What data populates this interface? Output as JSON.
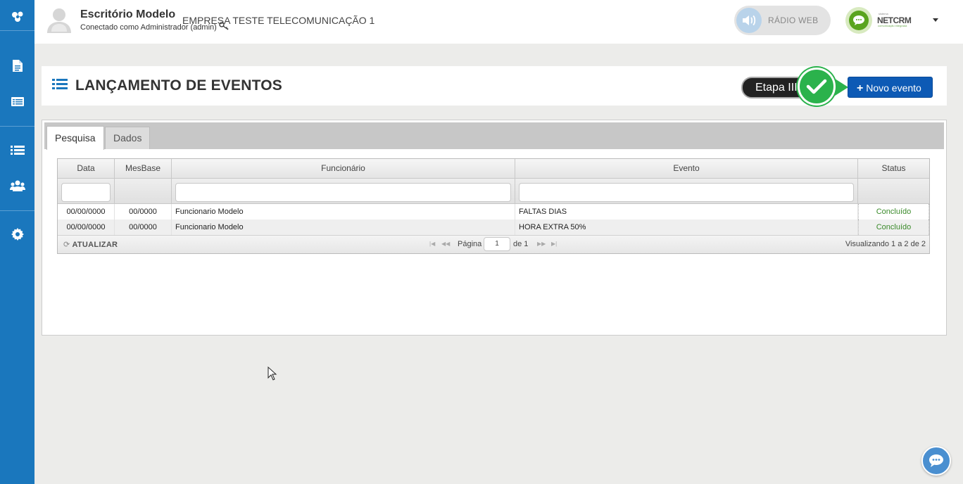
{
  "sidebar": {
    "items": [
      {
        "icon": "app-logo-icon"
      },
      {
        "icon": "document-icon"
      },
      {
        "icon": "card-list-icon"
      },
      {
        "icon": "list-icon"
      },
      {
        "icon": "users-icon"
      },
      {
        "icon": "gear-icon"
      }
    ],
    "color": "#1a77bd"
  },
  "topbar": {
    "office_name": "Escritório Modelo",
    "connected_as": "Conectado como Administrador (admin)",
    "company": "EMPRESA TESTE TELECOMUNICAÇÃO 1",
    "radio_label": "RÁDIO WEB",
    "logo_small": "sistema",
    "logo_text": "NETCRM",
    "logo_tagline": "comunicação integrada"
  },
  "header": {
    "title": "LANÇAMENTO DE EVENTOS",
    "etapa_label": "Etapa III",
    "new_event_label": "Novo evento",
    "accent": "#0d5ab5",
    "check_color": "#2bb24c"
  },
  "tabs": [
    {
      "label": "Pesquisa",
      "active": true
    },
    {
      "label": "Dados",
      "active": false
    }
  ],
  "grid": {
    "columns": [
      "Data",
      "MesBase",
      "Funcionário",
      "Evento",
      "Status"
    ],
    "rows": [
      {
        "data": "00/00/0000",
        "mesbase": "00/0000",
        "funcionario": "Funcionario Modelo",
        "evento": "FALTAS DIAS",
        "status": "Concluído"
      },
      {
        "data": "00/00/0000",
        "mesbase": "00/0000",
        "funcionario": "Funcionario Modelo",
        "evento": "HORA EXTRA 50%",
        "status": "Concluído"
      }
    ],
    "pager": {
      "refresh_label": "ATUALIZAR",
      "page_label": "Página",
      "page_value": "1",
      "of_label": "de 1",
      "view_label": "Visualizando 1 a 2 de 2"
    },
    "status_color": "#3a8a2a"
  }
}
